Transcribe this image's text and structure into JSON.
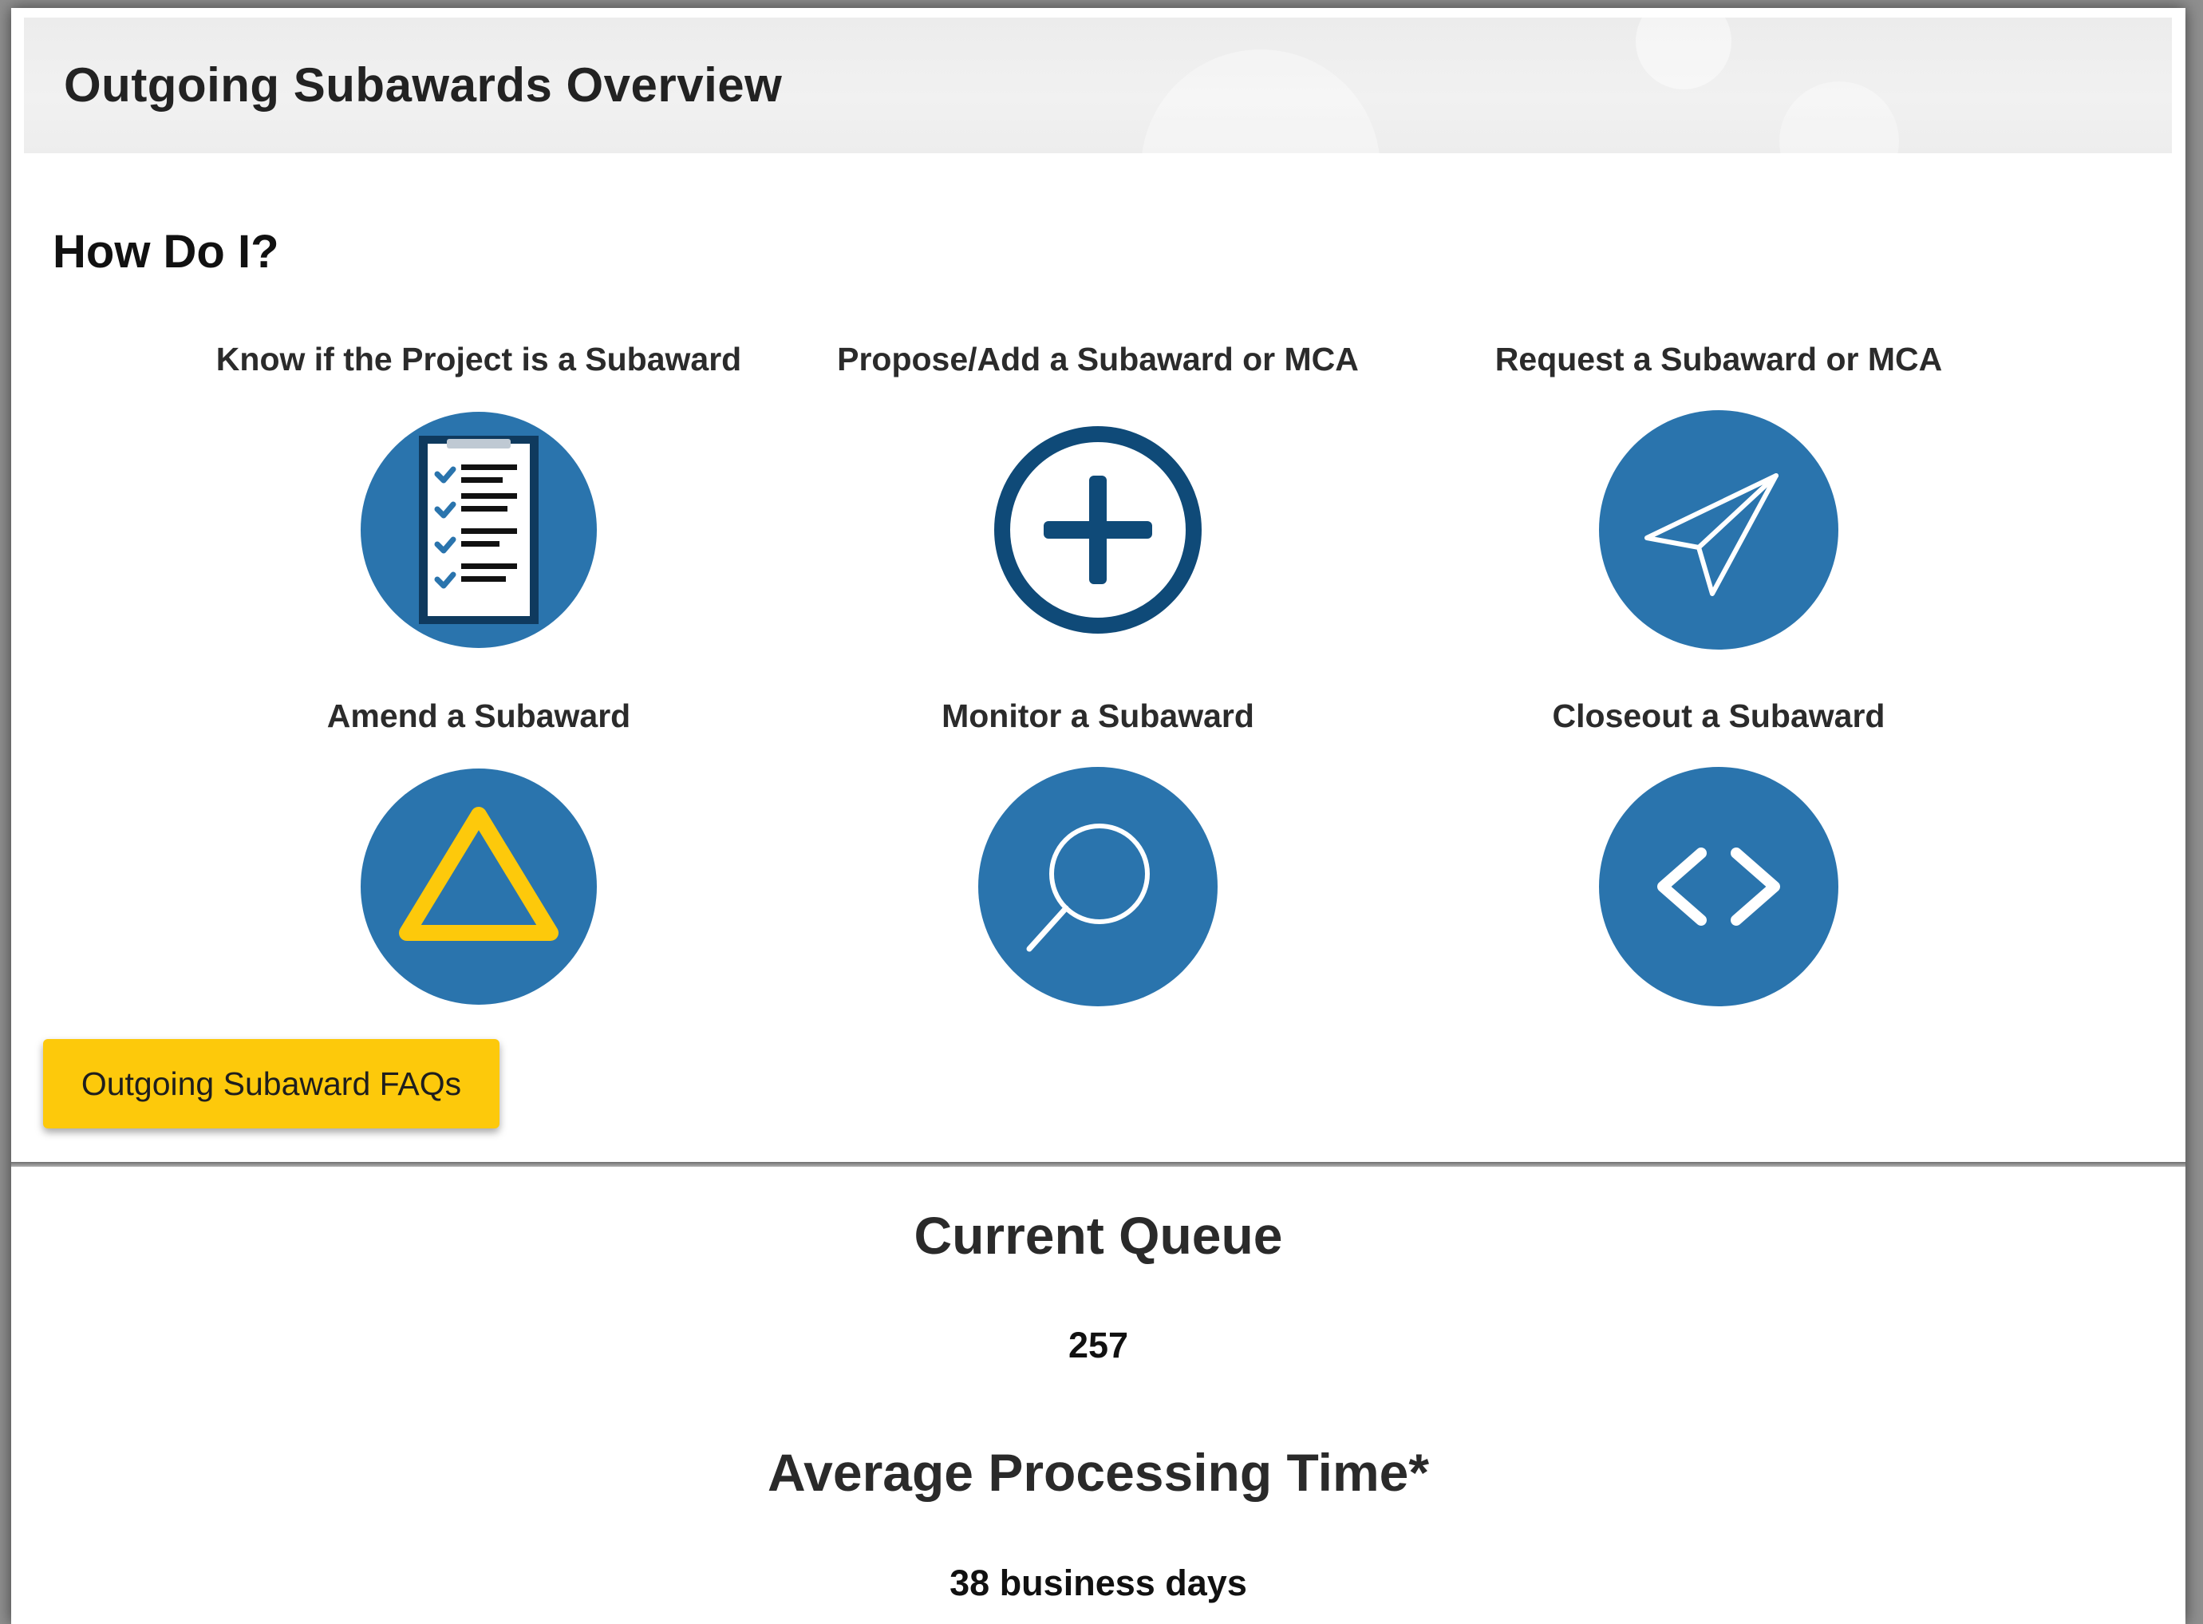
{
  "header": {
    "title": "Outgoing Subawards Overview"
  },
  "how_do_i": {
    "heading": "How Do I?",
    "tiles": [
      {
        "label": "Know if the Project is a Subaward",
        "icon": "clipboard-checklist-icon"
      },
      {
        "label": "Propose/Add a Subaward or MCA",
        "icon": "plus-circle-icon"
      },
      {
        "label": "Request a Subaward or MCA",
        "icon": "paper-plane-icon"
      },
      {
        "label": "Amend a Subaward",
        "icon": "triangle-delta-icon"
      },
      {
        "label": "Monitor a Subaward",
        "icon": "magnifier-icon"
      },
      {
        "label": "Closeout a Subaward",
        "icon": "angle-brackets-icon"
      }
    ]
  },
  "faq_button": {
    "label": "Outgoing Subaward FAQs"
  },
  "stats": {
    "queue_heading": "Current Queue",
    "queue_value": "257",
    "processing_heading": "Average Processing Time*",
    "processing_value": "38 business days"
  },
  "colors": {
    "icon_blue": "#2a74ad",
    "icon_dark_navy": "#0f4a78",
    "accent_yellow": "#fdc90b",
    "white": "#ffffff"
  }
}
